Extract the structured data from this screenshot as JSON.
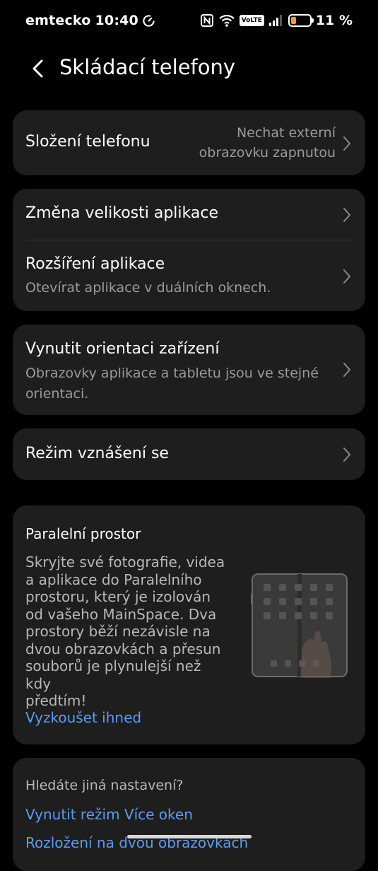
{
  "status_bar": {
    "carrier": "emtecko",
    "time": "10:40",
    "battery_percent": "11 %",
    "volte_label": "VoLTE",
    "battery_level": 0.11,
    "icons": [
      "timer-icon",
      "nfc-icon",
      "wifi-icon",
      "volte-icon",
      "signal-icon",
      "battery-icon"
    ]
  },
  "header": {
    "title": "Skládací telefony",
    "back_icon": "chevron-left-icon"
  },
  "settings": {
    "fold": {
      "title": "Složení telefonu",
      "value_line1": "Nechat externí",
      "value_line2": "obrazovku zapnutou"
    },
    "resize": {
      "title": "Změna velikosti aplikace"
    },
    "expand": {
      "title": "Rozšíření aplikace",
      "subtitle": "Otevírat aplikace v duálních oknech."
    },
    "orientation": {
      "title": "Vynutit orientaci zařízení",
      "subtitle_line1": "Obrazovky aplikace a tabletu jsou ve stejné",
      "subtitle_line2": "orientaci."
    },
    "hover": {
      "title": "Režim vznášení se"
    }
  },
  "promo": {
    "title": "Paralelní prostor",
    "body_lines": [
      "Skryjte své fotografie, videa",
      "a aplikace do Paralelního",
      "prostoru, který je izolován",
      "od vašeho MainSpace. Dva",
      "prostory běží nezávisle na",
      "dvou obrazovkách a přesun",
      "souborů je plynulejší než kdy",
      "předtím!"
    ],
    "link": "Vyzkoušet ihned"
  },
  "more": {
    "title": "Hledáte jiná nastavení?",
    "link1": "Vynutit režim Více oken",
    "link2": "Rozložení na dvou obrazovkách"
  },
  "colors": {
    "background": "#000000",
    "card": "#1e1e1e",
    "accent_link": "#5c9cf0",
    "battery": "#f29b2e"
  }
}
